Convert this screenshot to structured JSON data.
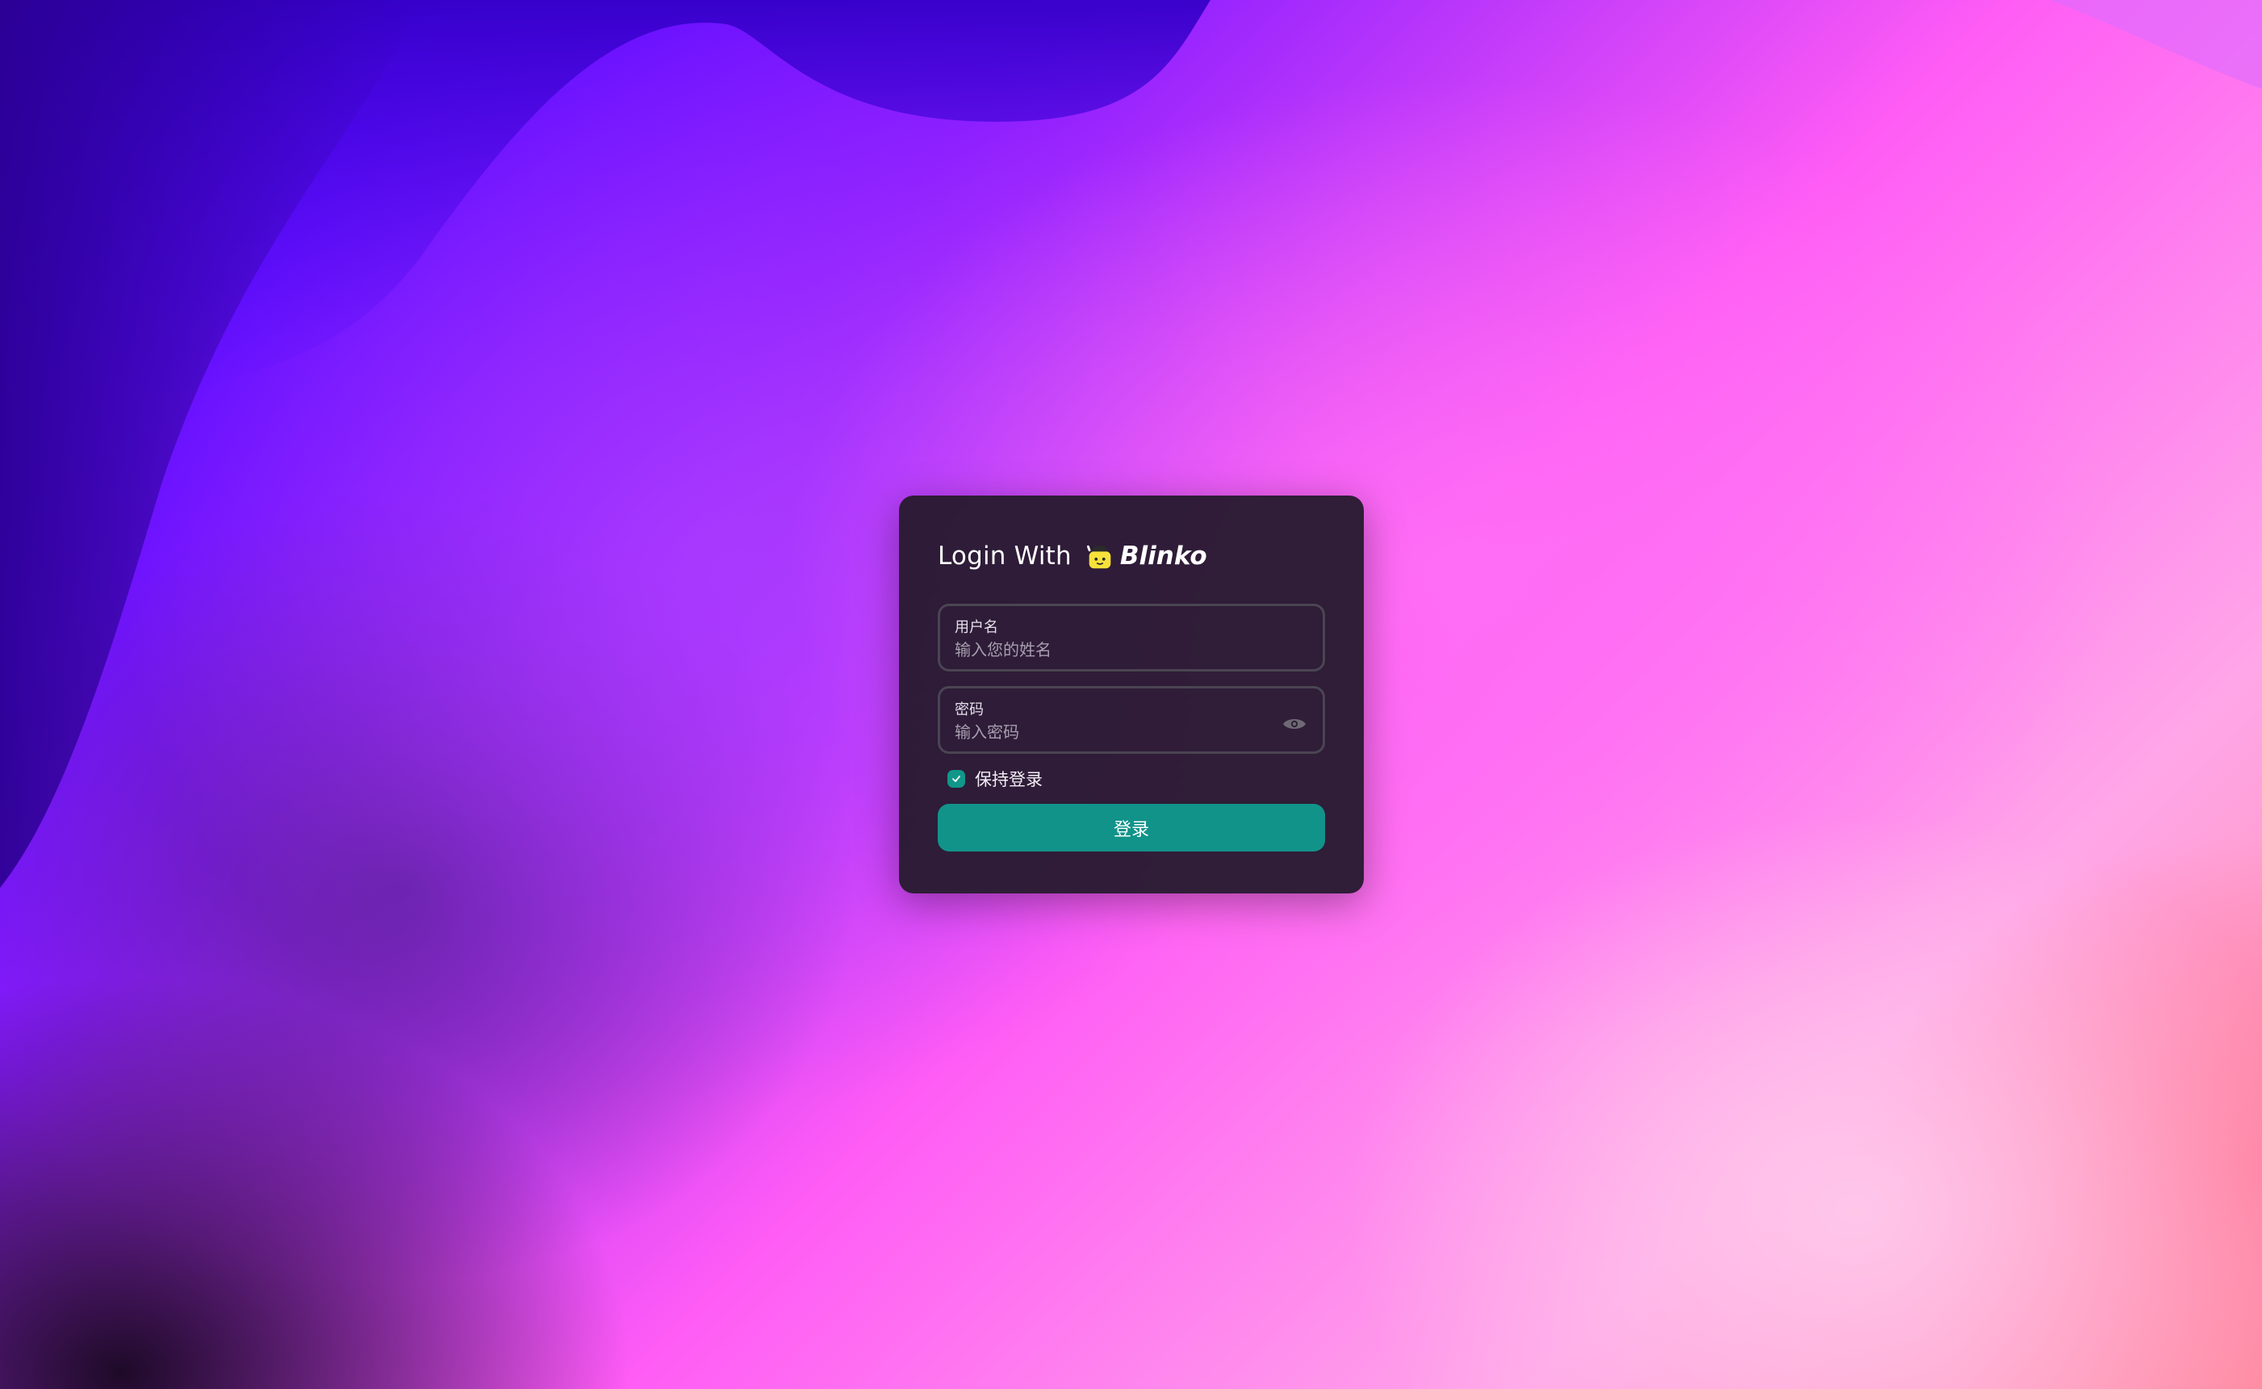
{
  "login": {
    "title": "Login With",
    "brand_name": "Blinko",
    "username_label": "用户名",
    "username_placeholder": "输入您的姓名",
    "username_value": "",
    "password_label": "密码",
    "password_placeholder": "输入密码",
    "password_value": "",
    "remember_label": "保持登录",
    "remember_checked": true,
    "submit_label": "登录"
  },
  "icons": {
    "brand": "blinko-logo-icon",
    "password_toggle": "eye-icon",
    "checkbox_check": "check-icon"
  },
  "colors": {
    "card": "#281a30",
    "accent": "#11938a",
    "field_border": "#4a4552",
    "text": "#ffffff"
  }
}
